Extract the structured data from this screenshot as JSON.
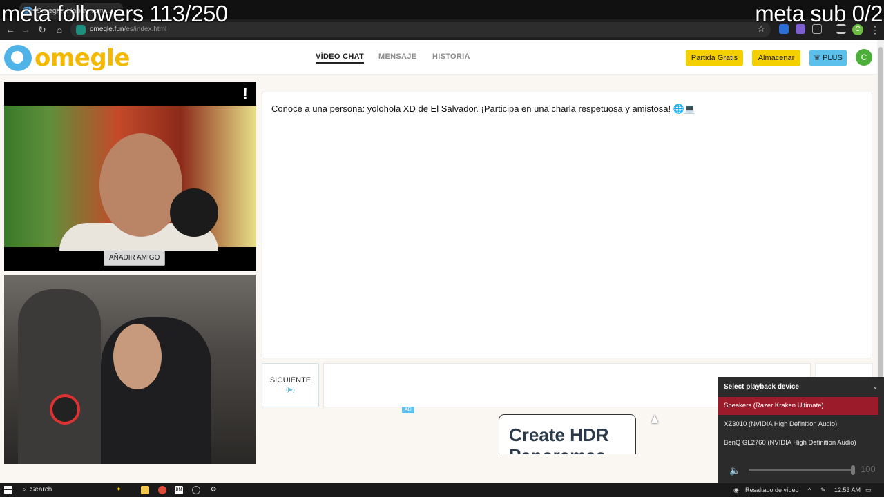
{
  "overlay": {
    "left": "meta followers 113/250",
    "right": "meta sub 0/2"
  },
  "browser": {
    "tab_title": "Omegle: Hablar con…",
    "url_host": "omegle.fun",
    "url_path": "/es/index.html",
    "profile_initial": "C"
  },
  "site": {
    "logo_text": "omegle",
    "nav": [
      "VÍDEO CHAT",
      "MENSAJE",
      "HISTORIA"
    ],
    "buttons": {
      "free_match": "Partida Gratis",
      "store": "Almacenar",
      "plus": "PLUS"
    },
    "avatar_initial": "C",
    "colors": {
      "brand_yellow": "#f5b800",
      "brand_blue": "#4fb3e8",
      "plus_blue": "#5bc0eb"
    }
  },
  "video": {
    "alert_mark": "!",
    "add_friend": "AÑADIR AMIGO"
  },
  "chat": {
    "message": "Conoce a una persona: yolohola XD de El Salvador. ¡Participa en una charla respetuosa y amistosa! 🌐💻",
    "next_label": "SIGUIENTE",
    "next_hint": "(▶)",
    "input_value": "",
    "ad_badge": "AD",
    "ad_headline": "Create HDR Panoramas"
  },
  "playback": {
    "title": "Select playback device",
    "devices": [
      {
        "label": "Speakers (Razer Kraken Ultimate)",
        "selected": true
      },
      {
        "label": "XZ3010 (NVIDIA High Definition Audio)",
        "selected": false
      },
      {
        "label": "BenQ GL2760 (NVIDIA High Definition Audio)",
        "selected": false
      }
    ],
    "volume": "100"
  },
  "taskbar": {
    "search": "Search",
    "tray_label": "Resaltado de vídeo",
    "clock": "12:53 AM",
    "apps": [
      "BM"
    ]
  }
}
